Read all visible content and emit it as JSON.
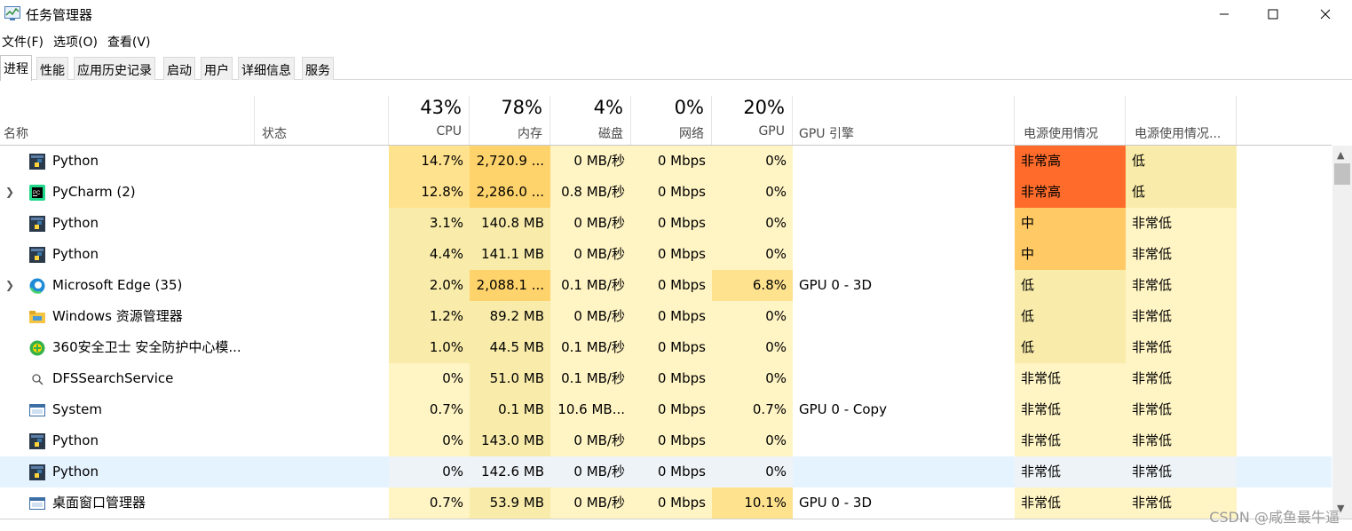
{
  "window": {
    "title": "任务管理器",
    "minimize_icon": "minimize-icon",
    "maximize_icon": "maximize-icon",
    "close_icon": "close-icon"
  },
  "menu": [
    "文件(F)",
    "选项(O)",
    "查看(V)"
  ],
  "tabs": [
    "进程",
    "性能",
    "应用历史记录",
    "启动",
    "用户",
    "详细信息",
    "服务"
  ],
  "active_tab": "进程",
  "columns": {
    "name": "名称",
    "status": "状态",
    "cpu": {
      "percent": "43%",
      "label": "CPU"
    },
    "memory": {
      "percent": "78%",
      "label": "内存"
    },
    "disk": {
      "percent": "4%",
      "label": "磁盘"
    },
    "network": {
      "percent": "0%",
      "label": "网络"
    },
    "gpu": {
      "percent": "20%",
      "label": "GPU"
    },
    "gpu_engine": "GPU 引擎",
    "power": "电源使用情况",
    "power_trend": "电源使用情况..."
  },
  "processes": [
    {
      "name": "Python",
      "icon": "python-icon",
      "expandable": false,
      "cpu": "14.7%",
      "memory": "2,720.9 ...",
      "disk": "0 MB/秒",
      "network": "0 Mbps",
      "gpu": "0%",
      "gpu_engine": "",
      "power": "非常高",
      "power_trend": "低",
      "selected": false
    },
    {
      "name": "PyCharm (2)",
      "icon": "pycharm-icon",
      "expandable": true,
      "cpu": "12.8%",
      "memory": "2,286.0 ...",
      "disk": "0.8 MB/秒",
      "network": "0 Mbps",
      "gpu": "0%",
      "gpu_engine": "",
      "power": "非常高",
      "power_trend": "低",
      "selected": false
    },
    {
      "name": "Python",
      "icon": "python-icon",
      "expandable": false,
      "cpu": "3.1%",
      "memory": "140.8 MB",
      "disk": "0 MB/秒",
      "network": "0 Mbps",
      "gpu": "0%",
      "gpu_engine": "",
      "power": "中",
      "power_trend": "非常低",
      "selected": false
    },
    {
      "name": "Python",
      "icon": "python-icon",
      "expandable": false,
      "cpu": "4.4%",
      "memory": "141.1 MB",
      "disk": "0 MB/秒",
      "network": "0 Mbps",
      "gpu": "0%",
      "gpu_engine": "",
      "power": "中",
      "power_trend": "非常低",
      "selected": false
    },
    {
      "name": "Microsoft Edge (35)",
      "icon": "edge-icon",
      "expandable": true,
      "cpu": "2.0%",
      "memory": "2,088.1 ...",
      "disk": "0.1 MB/秒",
      "network": "0 Mbps",
      "gpu": "6.8%",
      "gpu_engine": "GPU 0 - 3D",
      "power": "低",
      "power_trend": "非常低",
      "selected": false
    },
    {
      "name": "Windows 资源管理器",
      "icon": "explorer-folder-icon",
      "expandable": false,
      "cpu": "1.2%",
      "memory": "89.2 MB",
      "disk": "0 MB/秒",
      "network": "0 Mbps",
      "gpu": "0%",
      "gpu_engine": "",
      "power": "低",
      "power_trend": "非常低",
      "selected": false
    },
    {
      "name": "360安全卫士 安全防护中心模...",
      "icon": "360-safe-icon",
      "expandable": false,
      "cpu": "1.0%",
      "memory": "44.5 MB",
      "disk": "0.1 MB/秒",
      "network": "0 Mbps",
      "gpu": "0%",
      "gpu_engine": "",
      "power": "低",
      "power_trend": "非常低",
      "selected": false
    },
    {
      "name": "DFSSearchService",
      "icon": "search-icon",
      "expandable": false,
      "cpu": "0%",
      "memory": "51.0 MB",
      "disk": "0.1 MB/秒",
      "network": "0 Mbps",
      "gpu": "0%",
      "gpu_engine": "",
      "power": "非常低",
      "power_trend": "非常低",
      "selected": false
    },
    {
      "name": "System",
      "icon": "system-window-icon",
      "expandable": false,
      "cpu": "0.7%",
      "memory": "0.1 MB",
      "disk": "10.6 MB...",
      "network": "0 Mbps",
      "gpu": "0.7%",
      "gpu_engine": "GPU 0 - Copy",
      "power": "非常低",
      "power_trend": "非常低",
      "selected": false
    },
    {
      "name": "Python",
      "icon": "python-icon",
      "expandable": false,
      "cpu": "0%",
      "memory": "143.0 MB",
      "disk": "0 MB/秒",
      "network": "0 Mbps",
      "gpu": "0%",
      "gpu_engine": "",
      "power": "非常低",
      "power_trend": "非常低",
      "selected": false
    },
    {
      "name": "Python",
      "icon": "python-icon",
      "expandable": false,
      "cpu": "0%",
      "memory": "142.6 MB",
      "disk": "0 MB/秒",
      "network": "0 Mbps",
      "gpu": "0%",
      "gpu_engine": "",
      "power": "非常低",
      "power_trend": "非常低",
      "selected": true
    },
    {
      "name": "桌面窗口管理器",
      "icon": "system-window-icon",
      "expandable": false,
      "cpu": "0.7%",
      "memory": "53.9 MB",
      "disk": "0 MB/秒",
      "network": "0 Mbps",
      "gpu": "10.1%",
      "gpu_engine": "GPU 0 - 3D",
      "power": "非常低",
      "power_trend": "非常低",
      "selected": false
    }
  ],
  "colors": {
    "heat_light": "#fff4c4",
    "heat_medium": "#f9ecaa",
    "heat_strong": "#ffe28e",
    "heat_hot": "#ffd36b",
    "power_very_high": "#ff6b2b",
    "power_medium": "#ffc966",
    "selected_row": "#e5f3ff"
  },
  "watermark": "CSDN @咸鱼最牛逼"
}
